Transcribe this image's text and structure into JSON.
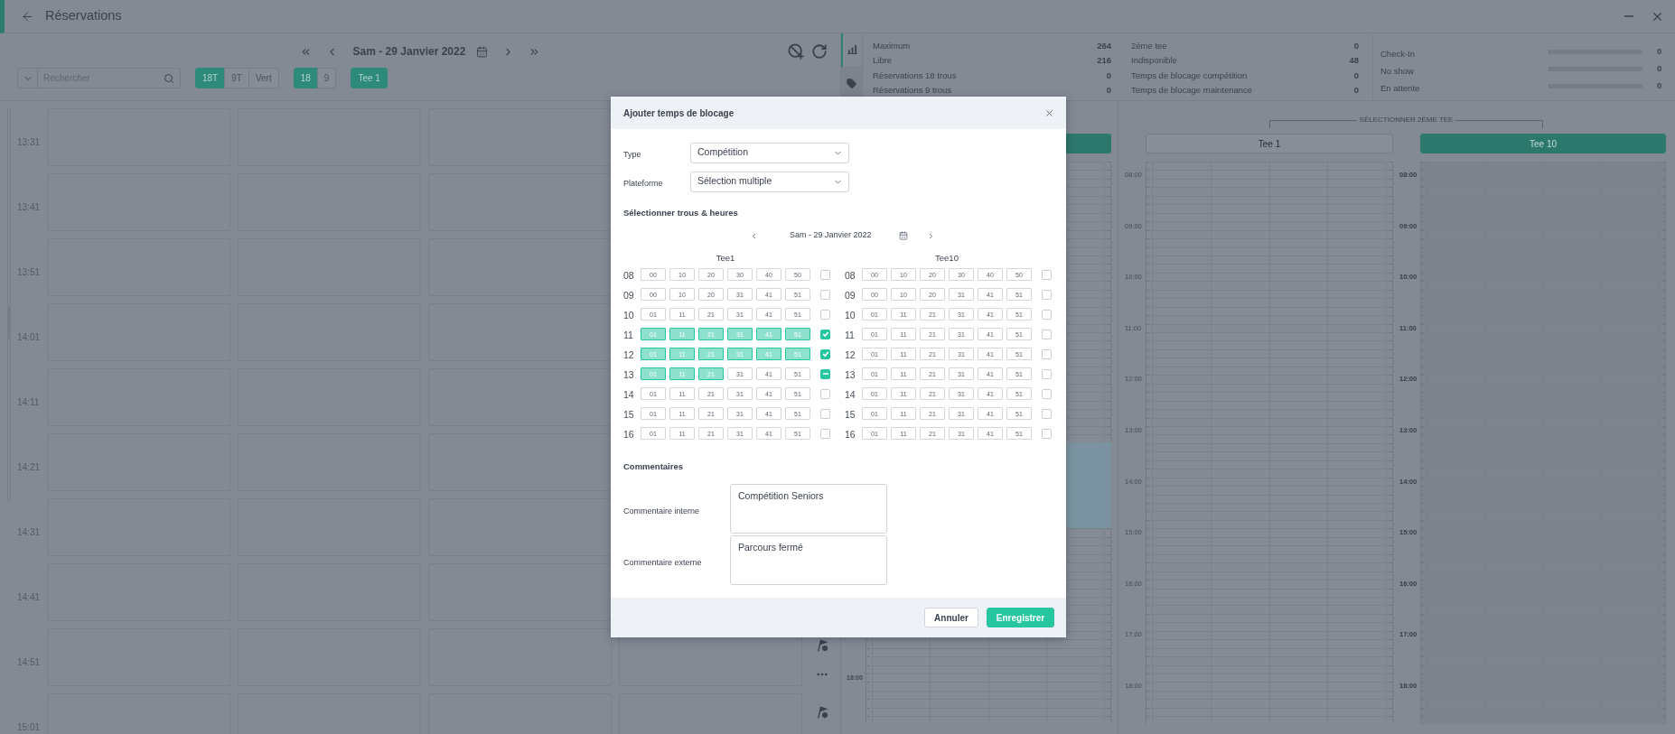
{
  "header": {
    "title": "Réservations"
  },
  "toolbar": {
    "date": "Sam - 29 Janvier 2022",
    "search": {
      "placeholder": "Rechercher"
    },
    "filter_groups": [
      {
        "options": [
          {
            "label": "18T",
            "selected": true
          },
          {
            "label": "9T",
            "selected": false
          },
          {
            "label": "Vert",
            "selected": false
          }
        ]
      },
      {
        "options": [
          {
            "label": "18",
            "selected": true
          },
          {
            "label": "9",
            "selected": false
          }
        ]
      },
      {
        "options": [
          {
            "label": "Tee 1",
            "selected": true
          }
        ]
      }
    ]
  },
  "side_tabs": [
    {
      "kind": "chart",
      "selected": true
    },
    {
      "kind": "tag",
      "selected": false
    }
  ],
  "stats": {
    "columns": [
      {
        "rows": [
          {
            "label": "Maximum",
            "value": "264"
          },
          {
            "label": "Libre",
            "value": "216"
          },
          {
            "label": "Réservations 18 trous",
            "value": "0"
          },
          {
            "label": "Réservations 9 trous",
            "value": "0"
          }
        ]
      },
      {
        "rows": [
          {
            "label": "2ème tee",
            "value": "0"
          },
          {
            "label": "Indisponible",
            "value": "48"
          },
          {
            "label": "Temps de blocage compétition",
            "value": "0"
          },
          {
            "label": "Temps de blocage maintenance",
            "value": "0"
          }
        ]
      }
    ],
    "progress": [
      {
        "label": "Check-In",
        "level": 0,
        "value": "0"
      },
      {
        "label": "No show",
        "level": 0,
        "value": "0"
      },
      {
        "label": "En attente",
        "level": 0,
        "value": "0"
      }
    ]
  },
  "schedule": {
    "times": [
      "13:31",
      "13:41",
      "13:51",
      "14:01",
      "14:11",
      "14:21",
      "14:31",
      "14:41",
      "14:51",
      "15:01"
    ]
  },
  "middle_panel": {
    "hours": [
      "18:00"
    ]
  },
  "second_tee": {
    "title": "SÉLECTIONNER 2ÈME TEE",
    "tees": [
      {
        "label": "Tee 1",
        "selected": false,
        "hours": [
          "08:00",
          "09:00",
          "10:00",
          "11:00",
          "12:00",
          "13:00",
          "14:00",
          "15:00",
          "16:00",
          "17:00",
          "18:00"
        ]
      },
      {
        "label": "Tee 10",
        "selected": true,
        "hours": [
          "08:00",
          "09:00",
          "10:00",
          "11:00",
          "12:00",
          "13:00",
          "14:00",
          "15:00",
          "16:00",
          "17:00",
          "18:00"
        ]
      }
    ]
  },
  "modal": {
    "title": "Ajouter temps de blocage",
    "fields": [
      {
        "label": "Type",
        "value": "Compétition"
      },
      {
        "label": "Plateforme",
        "value": "Sélection multiple"
      }
    ],
    "section_title": "Sélectionner trous & heures",
    "date": "Sam - 29 Janvier 2022",
    "tees": [
      {
        "name": "Tee1",
        "rows": [
          {
            "hour": "08",
            "checked": false,
            "indeterminate": false,
            "slots": [
              {
                "label": "00",
                "selected": false
              },
              {
                "label": "10",
                "selected": false
              },
              {
                "label": "20",
                "selected": false
              },
              {
                "label": "30",
                "selected": false
              },
              {
                "label": "40",
                "selected": false
              },
              {
                "label": "50",
                "selected": false
              }
            ]
          },
          {
            "hour": "09",
            "checked": false,
            "indeterminate": false,
            "slots": [
              {
                "label": "00",
                "selected": false
              },
              {
                "label": "10",
                "selected": false
              },
              {
                "label": "20",
                "selected": false
              },
              {
                "label": "31",
                "selected": false
              },
              {
                "label": "41",
                "selected": false
              },
              {
                "label": "51",
                "selected": false
              }
            ]
          },
          {
            "hour": "10",
            "checked": false,
            "indeterminate": false,
            "slots": [
              {
                "label": "01",
                "selected": false
              },
              {
                "label": "11",
                "selected": false
              },
              {
                "label": "21",
                "selected": false
              },
              {
                "label": "31",
                "selected": false
              },
              {
                "label": "41",
                "selected": false
              },
              {
                "label": "51",
                "selected": false
              }
            ]
          },
          {
            "hour": "11",
            "checked": true,
            "indeterminate": false,
            "slots": [
              {
                "label": "01",
                "selected": true
              },
              {
                "label": "11",
                "selected": true
              },
              {
                "label": "21",
                "selected": true
              },
              {
                "label": "31",
                "selected": true
              },
              {
                "label": "41",
                "selected": true
              },
              {
                "label": "51",
                "selected": true
              }
            ]
          },
          {
            "hour": "12",
            "checked": true,
            "indeterminate": false,
            "slots": [
              {
                "label": "01",
                "selected": true
              },
              {
                "label": "11",
                "selected": true
              },
              {
                "label": "21",
                "selected": true
              },
              {
                "label": "31",
                "selected": true
              },
              {
                "label": "41",
                "selected": true
              },
              {
                "label": "51",
                "selected": true
              }
            ]
          },
          {
            "hour": "13",
            "checked": false,
            "indeterminate": true,
            "slots": [
              {
                "label": "01",
                "selected": true
              },
              {
                "label": "11",
                "selected": true
              },
              {
                "label": "21",
                "selected": true
              },
              {
                "label": "31",
                "selected": false
              },
              {
                "label": "41",
                "selected": false
              },
              {
                "label": "51",
                "selected": false
              }
            ]
          },
          {
            "hour": "14",
            "checked": false,
            "indeterminate": false,
            "slots": [
              {
                "label": "01",
                "selected": false
              },
              {
                "label": "11",
                "selected": false
              },
              {
                "label": "21",
                "selected": false
              },
              {
                "label": "31",
                "selected": false
              },
              {
                "label": "41",
                "selected": false
              },
              {
                "label": "51",
                "selected": false
              }
            ]
          },
          {
            "hour": "15",
            "checked": false,
            "indeterminate": false,
            "slots": [
              {
                "label": "01",
                "selected": false
              },
              {
                "label": "11",
                "selected": false
              },
              {
                "label": "21",
                "selected": false
              },
              {
                "label": "31",
                "selected": false
              },
              {
                "label": "41",
                "selected": false
              },
              {
                "label": "51",
                "selected": false
              }
            ]
          },
          {
            "hour": "16",
            "checked": false,
            "indeterminate": false,
            "slots": [
              {
                "label": "01",
                "selected": false
              },
              {
                "label": "11",
                "selected": false
              },
              {
                "label": "21",
                "selected": false
              },
              {
                "label": "31",
                "selected": false
              },
              {
                "label": "41",
                "selected": false
              },
              {
                "label": "51",
                "selected": false
              }
            ]
          }
        ]
      },
      {
        "name": "Tee10",
        "rows": [
          {
            "hour": "08",
            "checked": false,
            "indeterminate": false,
            "slots": [
              {
                "label": "00",
                "selected": false
              },
              {
                "label": "10",
                "selected": false
              },
              {
                "label": "20",
                "selected": false
              },
              {
                "label": "30",
                "selected": false
              },
              {
                "label": "40",
                "selected": false
              },
              {
                "label": "50",
                "selected": false
              }
            ]
          },
          {
            "hour": "09",
            "checked": false,
            "indeterminate": false,
            "slots": [
              {
                "label": "00",
                "selected": false
              },
              {
                "label": "10",
                "selected": false
              },
              {
                "label": "20",
                "selected": false
              },
              {
                "label": "31",
                "selected": false
              },
              {
                "label": "41",
                "selected": false
              },
              {
                "label": "51",
                "selected": false
              }
            ]
          },
          {
            "hour": "10",
            "checked": false,
            "indeterminate": false,
            "slots": [
              {
                "label": "01",
                "selected": false
              },
              {
                "label": "11",
                "selected": false
              },
              {
                "label": "21",
                "selected": false
              },
              {
                "label": "31",
                "selected": false
              },
              {
                "label": "41",
                "selected": false
              },
              {
                "label": "51",
                "selected": false
              }
            ]
          },
          {
            "hour": "11",
            "checked": false,
            "indeterminate": false,
            "slots": [
              {
                "label": "01",
                "selected": false
              },
              {
                "label": "11",
                "selected": false
              },
              {
                "label": "21",
                "selected": false
              },
              {
                "label": "31",
                "selected": false
              },
              {
                "label": "41",
                "selected": false
              },
              {
                "label": "51",
                "selected": false
              }
            ]
          },
          {
            "hour": "12",
            "checked": false,
            "indeterminate": false,
            "slots": [
              {
                "label": "01",
                "selected": false
              },
              {
                "label": "11",
                "selected": false
              },
              {
                "label": "21",
                "selected": false
              },
              {
                "label": "31",
                "selected": false
              },
              {
                "label": "41",
                "selected": false
              },
              {
                "label": "51",
                "selected": false
              }
            ]
          },
          {
            "hour": "13",
            "checked": false,
            "indeterminate": false,
            "slots": [
              {
                "label": "01",
                "selected": false
              },
              {
                "label": "11",
                "selected": false
              },
              {
                "label": "21",
                "selected": false
              },
              {
                "label": "31",
                "selected": false
              },
              {
                "label": "41",
                "selected": false
              },
              {
                "label": "51",
                "selected": false
              }
            ]
          },
          {
            "hour": "14",
            "checked": false,
            "indeterminate": false,
            "slots": [
              {
                "label": "01",
                "selected": false
              },
              {
                "label": "11",
                "selected": false
              },
              {
                "label": "21",
                "selected": false
              },
              {
                "label": "31",
                "selected": false
              },
              {
                "label": "41",
                "selected": false
              },
              {
                "label": "51",
                "selected": false
              }
            ]
          },
          {
            "hour": "15",
            "checked": false,
            "indeterminate": false,
            "slots": [
              {
                "label": "01",
                "selected": false
              },
              {
                "label": "11",
                "selected": false
              },
              {
                "label": "21",
                "selected": false
              },
              {
                "label": "31",
                "selected": false
              },
              {
                "label": "41",
                "selected": false
              },
              {
                "label": "51",
                "selected": false
              }
            ]
          },
          {
            "hour": "16",
            "checked": false,
            "indeterminate": false,
            "slots": [
              {
                "label": "01",
                "selected": false
              },
              {
                "label": "11",
                "selected": false
              },
              {
                "label": "21",
                "selected": false
              },
              {
                "label": "31",
                "selected": false
              },
              {
                "label": "41",
                "selected": false
              },
              {
                "label": "51",
                "selected": false
              }
            ]
          }
        ]
      }
    ],
    "comments": {
      "title": "Commentaires",
      "fields": [
        {
          "label": "Commentaire interne",
          "value": "Compétition Seniors"
        },
        {
          "label": "Commentaire externe",
          "value": "Parcours fermé"
        }
      ]
    },
    "buttons": [
      {
        "label": "Annuler",
        "kind": "secondary"
      },
      {
        "label": "Enregistrer",
        "kind": "primary"
      }
    ]
  }
}
